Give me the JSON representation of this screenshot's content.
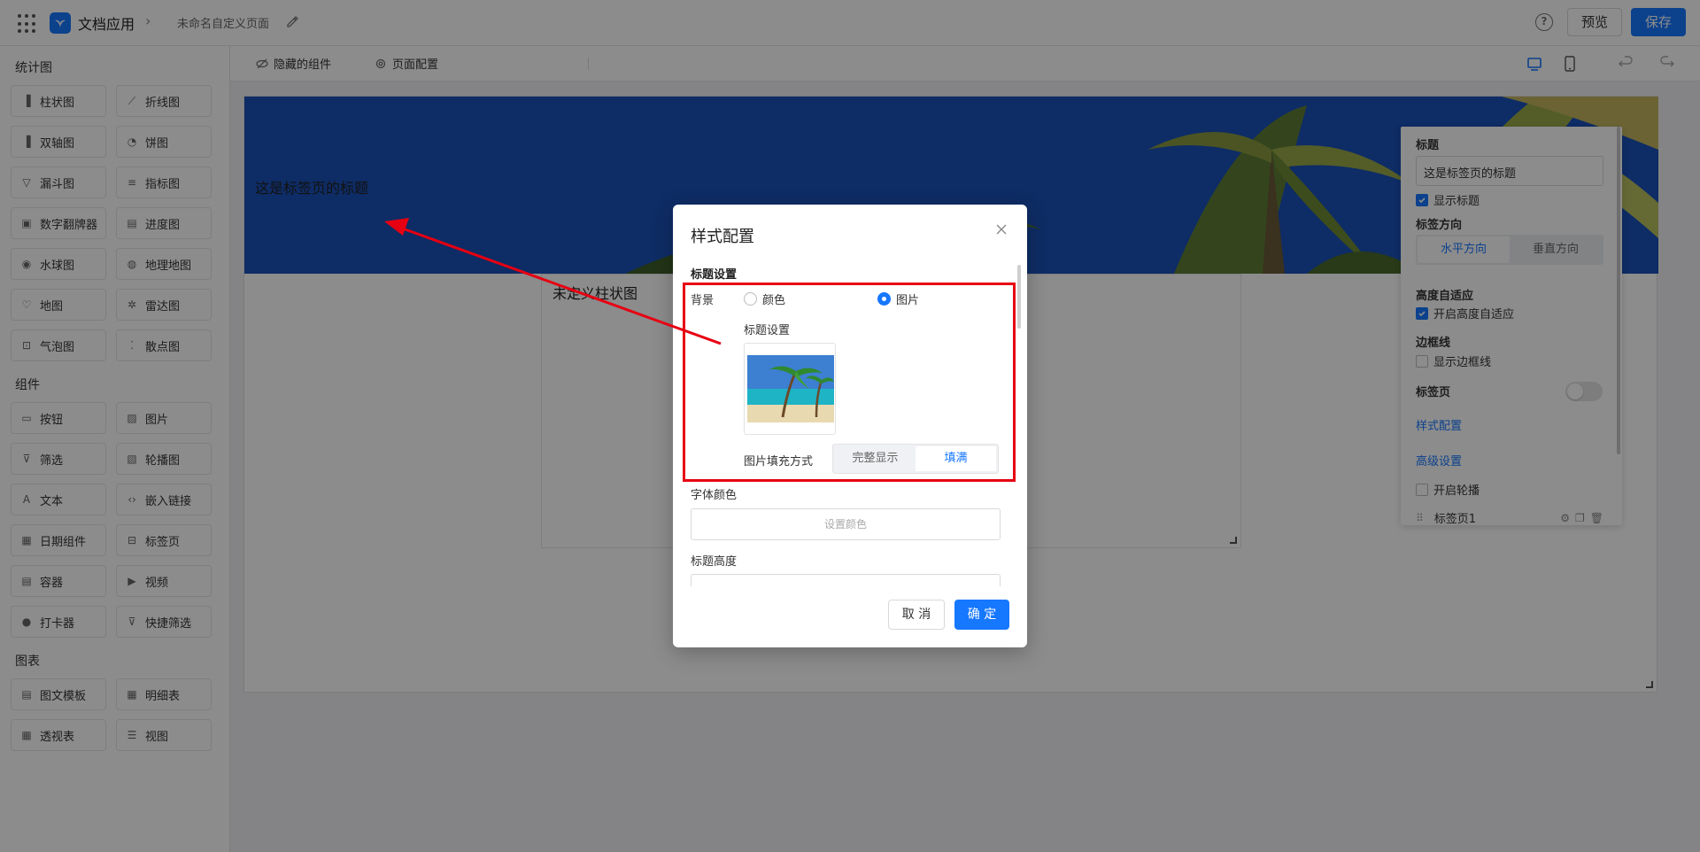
{
  "topbar": {
    "app_name": "文档应用",
    "page_name": "未命名自定义页面",
    "help_glyph": "?",
    "preview_label": "预览",
    "save_label": "保存"
  },
  "sidebar": {
    "section_stats": "统计图",
    "section_components": "组件",
    "section_tables": "图表",
    "stats_items": [
      "柱状图",
      "折线图",
      "双轴图",
      "饼图",
      "漏斗图",
      "指标图",
      "数字翻牌器",
      "进度图",
      "水球图",
      "地理地图",
      "地图",
      "雷达图",
      "气泡图",
      "散点图"
    ],
    "component_items": [
      "按钮",
      "图片",
      "筛选",
      "轮播图",
      "文本",
      "嵌入链接",
      "日期组件",
      "标签页",
      "容器",
      "视频",
      "打卡器",
      "快捷筛选"
    ],
    "table_items": [
      "图文模板",
      "明细表",
      "透视表",
      "视图"
    ]
  },
  "canvas_toolbar": {
    "hidden_components": "隐藏的组件",
    "page_config": "页面配置"
  },
  "canvas": {
    "banner_title": "这是标签页的标题",
    "chart_title": "未定义柱状图"
  },
  "prop_panel": {
    "title_label": "标题",
    "title_value": "这是标签页的标题",
    "show_title": "显示标题",
    "tab_direction_label": "标签方向",
    "dir_horizontal": "水平方向",
    "dir_vertical": "垂直方向",
    "auto_height_label": "高度自适应",
    "auto_height_check": "开启高度自适应",
    "border_label": "边框线",
    "border_check": "显示边框线",
    "tabs_label": "标签页",
    "style_config_link": "样式配置",
    "advanced_link": "高级设置",
    "carousel_check": "开启轮播",
    "tab_item": "标签页1"
  },
  "modal": {
    "title": "样式配置",
    "section_title": "标题设置",
    "background_label": "背景",
    "radio_color": "颜色",
    "radio_image": "图片",
    "image_setting_label": "标题设置",
    "fill_mode_label": "图片填充方式",
    "fill_full_display": "完整显示",
    "fill_fill": "填满",
    "font_color_label": "字体颜色",
    "font_color_placeholder": "设置颜色",
    "title_height_label": "标题高度",
    "cancel_label": "取 消",
    "ok_label": "确 定"
  },
  "colors": {
    "primary": "#1677ff",
    "annotation_red": "#e60012"
  }
}
